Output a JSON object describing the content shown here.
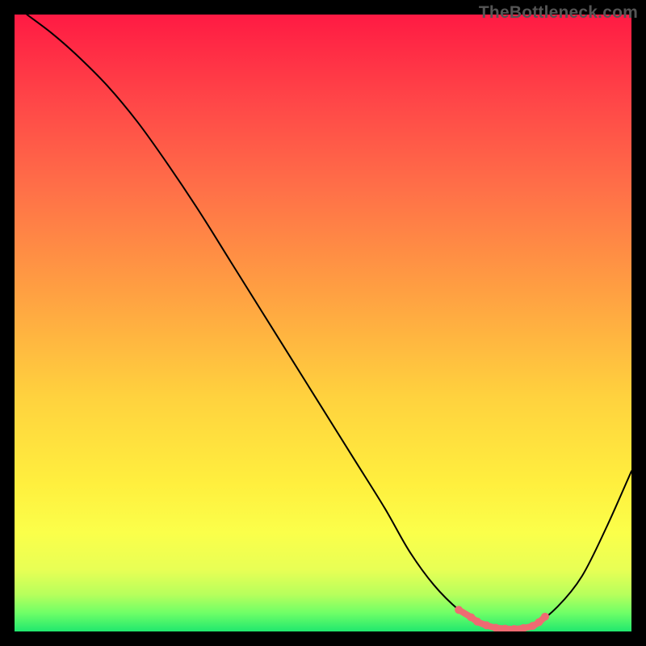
{
  "watermark": "TheBottleneck.com",
  "chart_data": {
    "type": "line",
    "title": "",
    "xlabel": "",
    "ylabel": "",
    "xlim": [
      0,
      100
    ],
    "ylim": [
      0,
      100
    ],
    "series": [
      {
        "name": "main-curve",
        "color": "#000000",
        "x": [
          2,
          6,
          10,
          15,
          20,
          25,
          30,
          35,
          40,
          45,
          50,
          55,
          60,
          64,
          68,
          72,
          75,
          78,
          81,
          84,
          88,
          92,
          96,
          100
        ],
        "values": [
          100,
          97,
          93.5,
          88.5,
          82.5,
          75.5,
          68,
          60,
          52,
          44,
          36,
          28,
          20,
          13,
          7.5,
          3.5,
          1.6,
          0.6,
          0.4,
          0.9,
          4,
          9,
          17,
          26
        ]
      },
      {
        "name": "highlight-segment",
        "color": "#ef7076",
        "x": [
          72,
          74,
          75,
          76.5,
          78,
          79.5,
          81,
          82.5,
          84,
          85,
          86
        ],
        "values": [
          3.5,
          2.3,
          1.6,
          1.0,
          0.6,
          0.45,
          0.4,
          0.55,
          0.9,
          1.5,
          2.4
        ]
      }
    ],
    "gradient_stops": [
      {
        "pos": 0,
        "color": "#ff1a44"
      },
      {
        "pos": 6,
        "color": "#ff2d45"
      },
      {
        "pos": 15,
        "color": "#ff4948"
      },
      {
        "pos": 28,
        "color": "#ff6f48"
      },
      {
        "pos": 45,
        "color": "#ffa042"
      },
      {
        "pos": 62,
        "color": "#ffd23e"
      },
      {
        "pos": 76,
        "color": "#ffef3e"
      },
      {
        "pos": 84,
        "color": "#fbff4a"
      },
      {
        "pos": 90,
        "color": "#e8ff55"
      },
      {
        "pos": 94,
        "color": "#b7ff5c"
      },
      {
        "pos": 97,
        "color": "#6fff67"
      },
      {
        "pos": 100,
        "color": "#20e86e"
      }
    ]
  }
}
